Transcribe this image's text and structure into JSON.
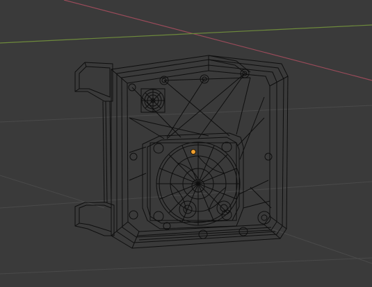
{
  "viewport": {
    "mode": "wireframe",
    "background_color": "#3a3a3a",
    "grid_color": "#4a4a4a",
    "x_axis_color": "#9a4b5a",
    "y_axis_color": "#6e8a3c",
    "wire_color": "#0e0e0e",
    "origin_color": "#f0a030",
    "object_icon": "origin-dot-icon"
  }
}
